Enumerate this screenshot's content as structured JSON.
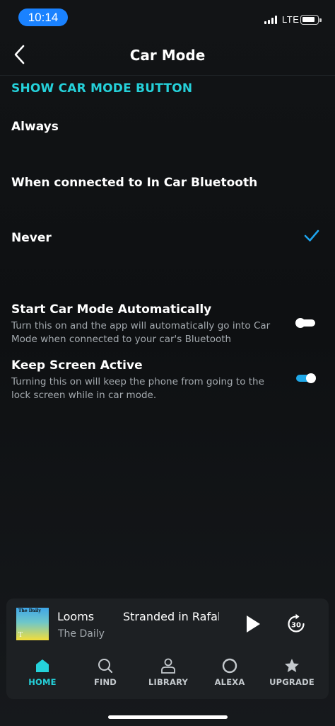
{
  "status_bar": {
    "time": "10:14",
    "network": "LTE",
    "signal_icon": "signal-bars-icon",
    "battery_icon": "battery-icon"
  },
  "header": {
    "title": "Car Mode",
    "back_icon": "chevron-left-icon"
  },
  "car_mode_button": {
    "heading": "SHOW CAR MODE BUTTON",
    "options": [
      {
        "label": "Always",
        "selected": false
      },
      {
        "label": "When connected to In Car Bluetooth",
        "selected": false
      },
      {
        "label": "Never",
        "selected": true
      }
    ]
  },
  "settings": {
    "start_auto": {
      "title": "Start Car Mode Automatically",
      "description": "Turn this on and the app will automatically go into Car Mode when connected to your car's Bluetooth",
      "enabled": false
    },
    "keep_screen": {
      "title": "Keep Screen Active",
      "description": "Turning this on will keep the phone from going to the lock screen while in car mode.",
      "enabled": true
    }
  },
  "player": {
    "episode_title": "Looms",
    "episode_title_2": "Stranded in Rafah",
    "show": "The Daily",
    "artwork_text": "The Daily",
    "artwork_mark": "T",
    "skip_label": "30"
  },
  "tabs": [
    {
      "label": "HOME",
      "icon": "home-icon",
      "active": true
    },
    {
      "label": "FIND",
      "icon": "search-icon",
      "active": false
    },
    {
      "label": "LIBRARY",
      "icon": "person-icon",
      "active": false
    },
    {
      "label": "ALEXA",
      "icon": "alexa-ring-icon",
      "active": false
    },
    {
      "label": "UPGRADE",
      "icon": "star-icon",
      "active": false
    }
  ],
  "colors": {
    "accent": "#25d1da",
    "check": "#1ea3ec",
    "toggle_on": "#1fa8e8",
    "time_pill": "#1a82ff"
  }
}
